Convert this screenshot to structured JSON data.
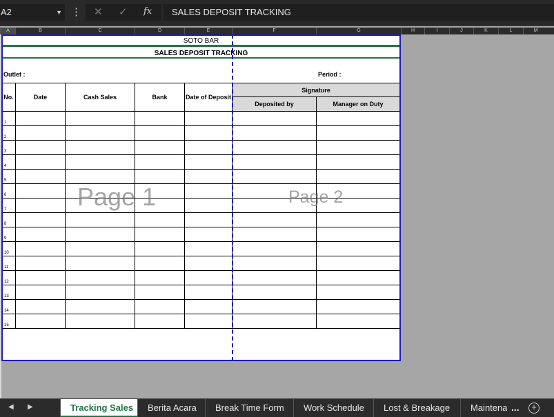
{
  "formula_bar": {
    "name_box": "A2",
    "cancel_icon": "✕",
    "enter_icon": "✓",
    "fx_label": "fx",
    "content": "SALES DEPOSIT TRACKING"
  },
  "columns": [
    "A",
    "B",
    "C",
    "D",
    "E",
    "F",
    "G",
    "H",
    "I",
    "J",
    "K",
    "L",
    "M"
  ],
  "sheet": {
    "title1": "SOTO BAR",
    "title2": "SALES DEPOSIT TRACKING",
    "outlet_label": "Outlet :",
    "period_label": "Period :",
    "headers": {
      "no": "No.",
      "date": "Date",
      "cash_sales": "Cash Sales",
      "bank": "Bank",
      "date_of_deposit": "Date of Deposit",
      "signature": "Signature",
      "deposited_by": "Deposited by",
      "manager_on_duty": "Manager on Duty"
    },
    "row_numbers": [
      "1",
      "2",
      "3",
      "4",
      "5",
      "6",
      "7",
      "8",
      "9",
      "10",
      "11",
      "12",
      "13",
      "14",
      "15"
    ],
    "page1_watermark": "Page 1",
    "page2_watermark": "Page 2"
  },
  "tabs": [
    "Tracking Sales",
    "Berita Acara",
    "Break Time Form",
    "Work Schedule",
    "Lost & Breakage",
    "Maintena"
  ],
  "active_tab": "Tracking Sales",
  "more_label": "...",
  "add_sheet": "+",
  "nav": {
    "prev": "◀",
    "next": "▶"
  },
  "colors": {
    "accent": "#217346",
    "page_border": "#1c1cb5"
  }
}
